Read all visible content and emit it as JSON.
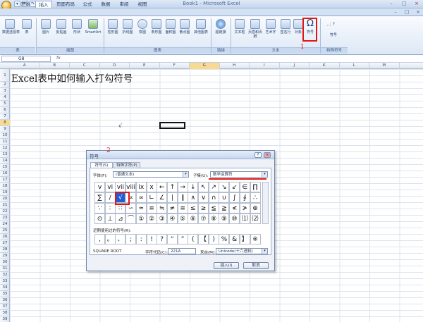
{
  "window": {
    "title": "Book1 - Microsoft Excel",
    "minimize": "–",
    "maximize": "□",
    "close": "×",
    "doc_minimize": "–",
    "doc_restore": "□",
    "doc_close": "×"
  },
  "quick_access": [
    "▾",
    "↶",
    "↷"
  ],
  "tabs": [
    "开始",
    "插入",
    "页面布局",
    "公式",
    "数据",
    "审阅",
    "视图"
  ],
  "active_tab": "插入",
  "ribbon": {
    "groups": [
      "表",
      "插图",
      "图表",
      "链接",
      "文本",
      "特殊符号"
    ],
    "buttons": {
      "pivot": "数据透视表",
      "table": "表",
      "picture": "图片",
      "clipart": "剪贴画",
      "shapes": "形状",
      "smartart": "SmartArt",
      "column": "柱形图",
      "line": "折线图",
      "pie": "饼图",
      "bar": "条形图",
      "area": "面积图",
      "scatter": "散点图",
      "other": "其他图表",
      "hyperlink": "超链接",
      "textbox": "文本框",
      "header": "页眉和页脚",
      "wordart": "艺术字",
      "signature": "签名行",
      "object": "对象",
      "symbol": "符号",
      "special_symbol": "符号"
    },
    "special_marks": "‚  ;  ?",
    "annotation_1": "1"
  },
  "formula_bar": {
    "name_box": "G8",
    "fx": "fx"
  },
  "columns": [
    "A",
    "B",
    "C",
    "D",
    "E",
    "F",
    "G",
    "H",
    "I",
    "J",
    "K",
    "L",
    "M"
  ],
  "rows": [
    "1",
    "2",
    "3",
    "4",
    "5",
    "6",
    "7",
    "8",
    "9",
    "10",
    "11",
    "12",
    "13",
    "14",
    "15",
    "16",
    "17",
    "18",
    "19",
    "20",
    "21",
    "22",
    "23",
    "24",
    "25",
    "26",
    "27",
    "28",
    "29",
    "30",
    "31",
    "32",
    "33",
    "34",
    "35",
    "36",
    "37",
    "38",
    "39"
  ],
  "sheet": {
    "heading": "Excel表中如何输入打勾符号",
    "check_text": "√"
  },
  "dialog": {
    "title": "符号",
    "help": "?",
    "close": "×",
    "annotation_2": "2",
    "tabs": [
      "符号(S)",
      "特殊字符(P)"
    ],
    "font_label": "字体(F):",
    "font_value": "(普通文本)",
    "subset_label": "子集(U):",
    "subset_value": "数学运算符",
    "grid": [
      [
        "v",
        "vi",
        "vii",
        "viii",
        "ix",
        "x",
        "←",
        "↑",
        "→",
        "↓",
        "↖",
        "↗",
        "↘",
        "↙",
        "∈",
        "∏"
      ],
      [
        "∑",
        "/",
        "√",
        "∝",
        "∞",
        "∟",
        "∠",
        "∣",
        "∥",
        "∧",
        "∨",
        "∩",
        "∪",
        "∫",
        "∮",
        "∴"
      ],
      [
        "∵",
        "∶",
        "∷",
        "∽",
        "≈",
        "≌",
        "≒",
        "≠",
        "≡",
        "≤",
        "≥",
        "≦",
        "≧",
        "≮",
        "≯",
        "⊕"
      ],
      [
        "⊙",
        "⊥",
        "⊿",
        "⌒",
        "①",
        "②",
        "③",
        "④",
        "⑤",
        "⑥",
        "⑦",
        "⑧",
        "⑨",
        "⑩",
        "⑴",
        "⑵"
      ]
    ],
    "selected_symbol": "√",
    "recent_label": "近期使用过的符号(R):",
    "recent": [
      ",",
      "。",
      "、",
      ";",
      ":",
      "!",
      "?",
      "“",
      "”",
      "(",
      "【",
      ")",
      "%",
      "&",
      "】",
      "※"
    ],
    "char_name": "SQUARE ROOT",
    "code_label": "字符代码(C):",
    "code_value": "221A",
    "from_label": "来自(M):",
    "from_value": "Unicode(十六进制)",
    "insert": "插入(I)",
    "cancel": "取消"
  }
}
